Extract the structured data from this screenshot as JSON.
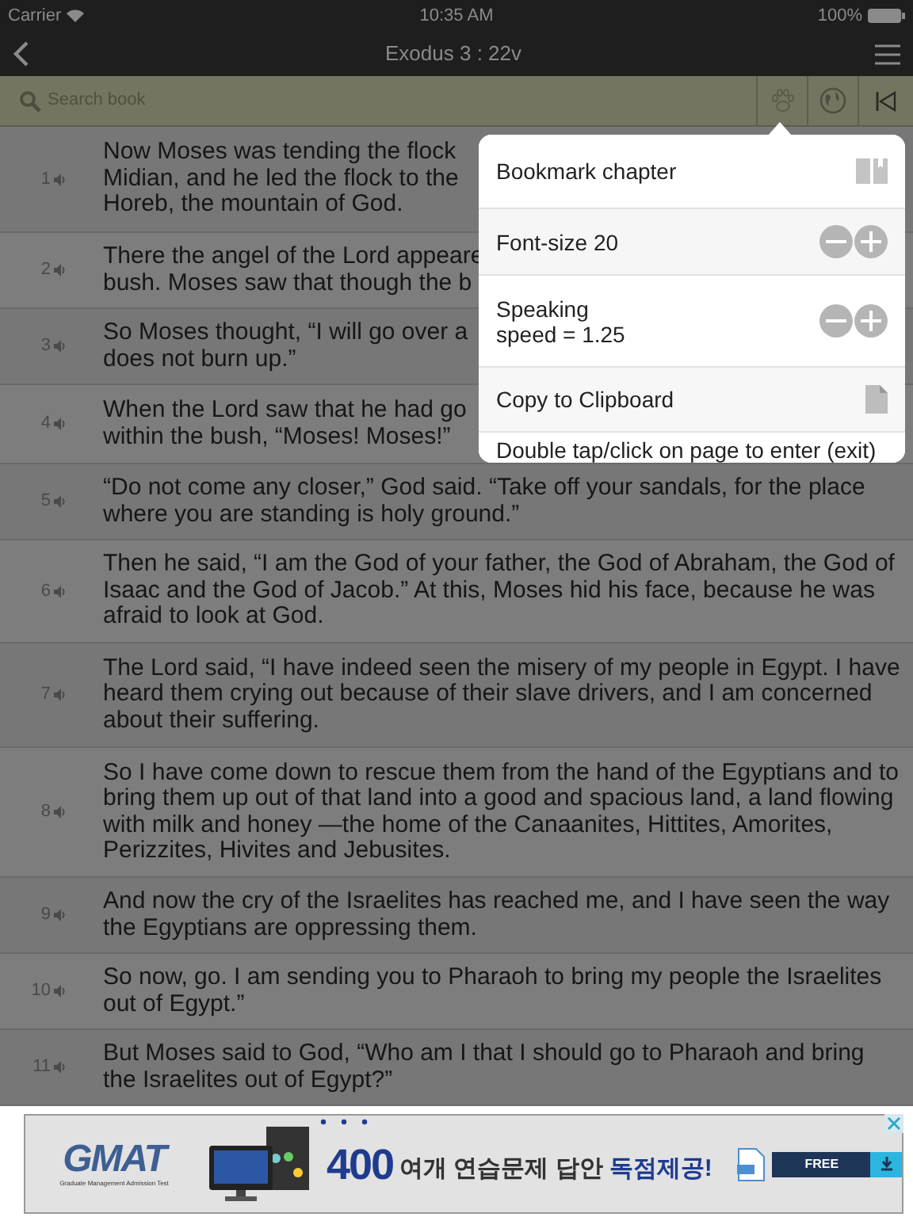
{
  "status_bar": {
    "carrier": "Carrier",
    "time": "10:35 AM",
    "battery": "100%"
  },
  "nav": {
    "title": "Exodus 3 : 22v"
  },
  "search": {
    "placeholder": "Search book"
  },
  "verses": [
    {
      "number": "1",
      "lines": [
        "Now Moses was tending the flock",
        "Midian, and he led the flock to the",
        "Horeb, the mountain of God."
      ]
    },
    {
      "number": "2",
      "lines": [
        "There the angel of the Lord appeare",
        "bush. Moses saw that though the b"
      ]
    },
    {
      "number": "3",
      "lines": [
        "So Moses thought, “I will go over a",
        "does not burn up.”"
      ]
    },
    {
      "number": "4",
      "lines": [
        "When the Lord saw that he had go",
        "within the bush, “Moses! Moses!”"
      ]
    },
    {
      "number": "5",
      "text": "“Do not come any closer,” God said. “Take off your sandals, for the place where you are standing is holy ground.”"
    },
    {
      "number": "6",
      "text": "Then he said, “I am the God of your father, the God of Abraham, the God of Isaac and the God of Jacob.” At this, Moses hid his face, because he was afraid to look at God."
    },
    {
      "number": "7",
      "text": "The Lord said, “I have indeed seen the misery of my people in Egypt. I have heard them crying out because of their slave drivers, and I am concerned about their suffering."
    },
    {
      "number": "8",
      "text": "So I have come down to rescue them from the hand of the Egyptians and to bring them up out of that land into a good and spacious land, a land flowing with milk and honey —the home of the Canaanites, Hittites, Amorites, Perizzites, Hivites and Jebusites."
    },
    {
      "number": "9",
      "text": "And now the cry of the Israelites has reached me, and I have seen the way the Egyptians are oppressing them."
    },
    {
      "number": "10",
      "text": "So now, go. I am sending you to Pharaoh to bring my people the Israelites out of Egypt.”"
    },
    {
      "number": "11",
      "text": "But Moses said to God, “Who am I that I should go to Pharaoh and bring the Israelites out of Egypt?”"
    }
  ],
  "menu": [
    {
      "kind": "bookmark",
      "label": "Bookmark chapter"
    },
    {
      "kind": "stepper",
      "label": "Font-size 20"
    },
    {
      "kind": "stepper",
      "label": "Speaking\nspeed = 1.25"
    },
    {
      "kind": "copy",
      "label": "Copy to Clipboard"
    },
    {
      "kind": "note",
      "label": "Double tap/click on page to enter (exit)"
    }
  ],
  "ad": {
    "logo": "GMAT",
    "tagline": "Graduate Management Admission Test",
    "headline": "400",
    "headline_rest": "여개 연습문제 답안 ",
    "headline_highlight": "독점제공!",
    "button": "FREE"
  }
}
